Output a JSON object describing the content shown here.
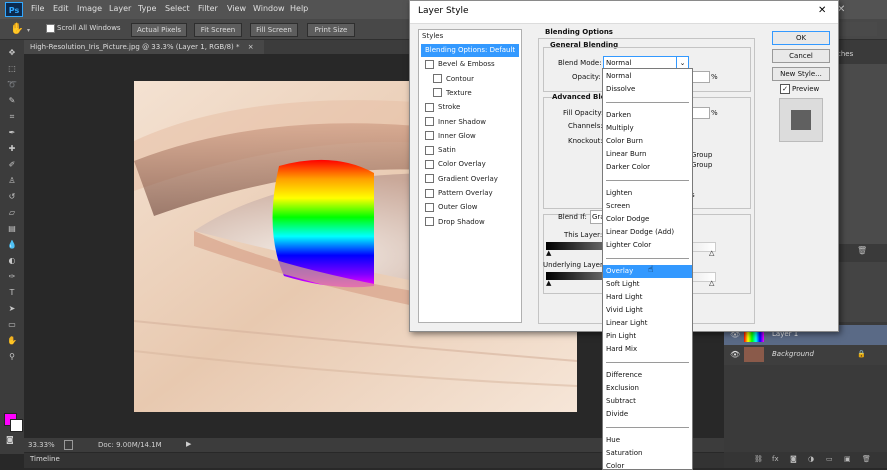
{
  "app": {
    "logo": "Ps"
  },
  "menu": [
    "File",
    "Edit",
    "Image",
    "Layer",
    "Type",
    "Select",
    "Filter",
    "View",
    "Window",
    "Help"
  ],
  "options_bar": {
    "scroll_all_windows": "Scroll All Windows",
    "buttons": [
      "Actual Pixels",
      "Fit Screen",
      "Fill Screen",
      "Print Size"
    ]
  },
  "document_tab": {
    "title": "High-Resolution_Iris_Picture.jpg @ 33.3% (Layer 1, RGB/8) *",
    "close": "×"
  },
  "status": {
    "zoom": "33.33%",
    "doc": "Doc: 9.00M/14.1M"
  },
  "timeline": {
    "label": "Timeline"
  },
  "right_panel": {
    "tab_label": "ches",
    "layers": [
      {
        "name": "Layer 1"
      },
      {
        "name": "Background"
      }
    ]
  },
  "dialog": {
    "title": "Layer Style",
    "close": "✕",
    "styles_header": "Styles",
    "styles": [
      {
        "label": "Blending Options: Default",
        "selected": true,
        "checkbox": false,
        "indent": false
      },
      {
        "label": "Bevel & Emboss",
        "checkbox": true,
        "indent": false
      },
      {
        "label": "Contour",
        "checkbox": true,
        "indent": true
      },
      {
        "label": "Texture",
        "checkbox": true,
        "indent": true
      },
      {
        "label": "Stroke",
        "checkbox": true,
        "indent": false
      },
      {
        "label": "Inner Shadow",
        "checkbox": true,
        "indent": false
      },
      {
        "label": "Inner Glow",
        "checkbox": true,
        "indent": false
      },
      {
        "label": "Satin",
        "checkbox": true,
        "indent": false
      },
      {
        "label": "Color Overlay",
        "checkbox": true,
        "indent": false
      },
      {
        "label": "Gradient Overlay",
        "checkbox": true,
        "indent": false
      },
      {
        "label": "Pattern Overlay",
        "checkbox": true,
        "indent": false
      },
      {
        "label": "Outer Glow",
        "checkbox": true,
        "indent": false
      },
      {
        "label": "Drop Shadow",
        "checkbox": true,
        "indent": false
      }
    ],
    "blending_options": {
      "heading": "Blending Options",
      "general_blending": "General Blending",
      "blend_mode_label": "Blend Mode:",
      "blend_mode_value": "Normal",
      "opacity_label": "Opacity:",
      "percent": "%",
      "advanced_blending": "Advanced Ble",
      "fill_opacity_label": "Fill Opacity:",
      "channels_label": "Channels:",
      "knockout_label": "Knockout:",
      "group_text_1": "Group",
      "group_text_2": "Group",
      "s_text": "s",
      "blend_if_label": "Blend If:",
      "blend_if_value": "Gra",
      "this_layer_label": "This Layer:",
      "underlying_layer_label": "Underlying Layer:"
    },
    "buttons": {
      "ok": "OK",
      "cancel": "Cancel",
      "new_style": "New Style...",
      "preview": "Preview"
    }
  },
  "blend_dropdown": {
    "groups": [
      [
        "Normal",
        "Dissolve"
      ],
      [
        "Darken",
        "Multiply",
        "Color Burn",
        "Linear Burn",
        "Darker Color"
      ],
      [
        "Lighten",
        "Screen",
        "Color Dodge",
        "Linear Dodge (Add)",
        "Lighter Color"
      ],
      [
        "Overlay",
        "Soft Light",
        "Hard Light",
        "Vivid Light",
        "Linear Light",
        "Pin Light",
        "Hard Mix"
      ],
      [
        "Difference",
        "Exclusion",
        "Subtract",
        "Divide"
      ],
      [
        "Hue",
        "Saturation",
        "Color"
      ]
    ],
    "highlighted": "Overlay"
  },
  "colors": {
    "selection_blue": "#3399ff",
    "foreground": "#ff00ff",
    "background": "#ffffff",
    "styles_selected": "#3399ff"
  }
}
